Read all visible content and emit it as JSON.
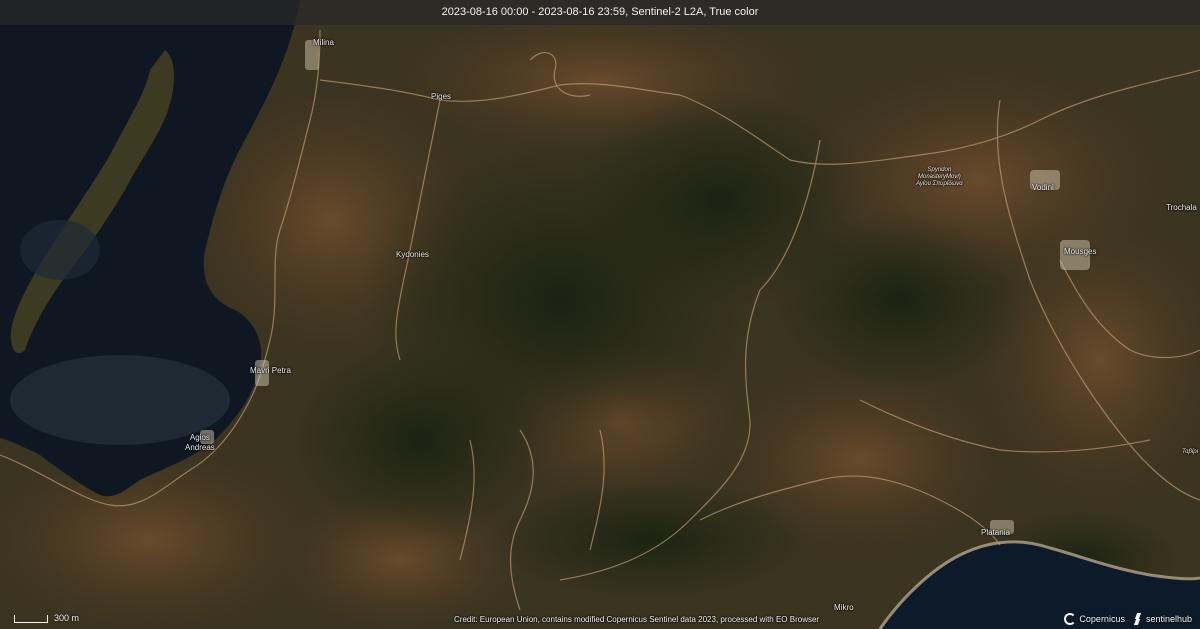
{
  "header": {
    "title": "2023-08-16 00:00 - 2023-08-16 23:59, Sentinel-2 L2A, True color"
  },
  "places": [
    {
      "id": "milina",
      "label": "Milina"
    },
    {
      "id": "piges",
      "label": "Piges"
    },
    {
      "id": "kydonies",
      "label": "Kydonies"
    },
    {
      "id": "mavri-petra",
      "label": "Mavri Petra"
    },
    {
      "id": "agios-andreas",
      "label": "Agios\nAndreas"
    },
    {
      "id": "spyridon",
      "label": "Spyridon\nMonasteryΜονή\nΑγίου Σπυρίδωνα"
    },
    {
      "id": "vodini",
      "label": "Vodini"
    },
    {
      "id": "trochala",
      "label": "Trochala"
    },
    {
      "id": "mousges",
      "label": "Mousges"
    },
    {
      "id": "tapiri",
      "label": "Ταβίρι"
    },
    {
      "id": "platania",
      "label": "Platania"
    },
    {
      "id": "mikro",
      "label": "Mikro"
    }
  ],
  "scale": {
    "label": "300 m"
  },
  "credit": "Credit: European Union, contains modified Copernicus Sentinel data 2023, processed with EO Browser",
  "logos": {
    "copernicus": "Copernicus",
    "sentinelhub": "sentinelhub"
  },
  "colors": {
    "sea": "#0f1a24",
    "forest": "#1f2a14",
    "dry_land": "#6b4a2a",
    "road": "#c9a27a"
  }
}
